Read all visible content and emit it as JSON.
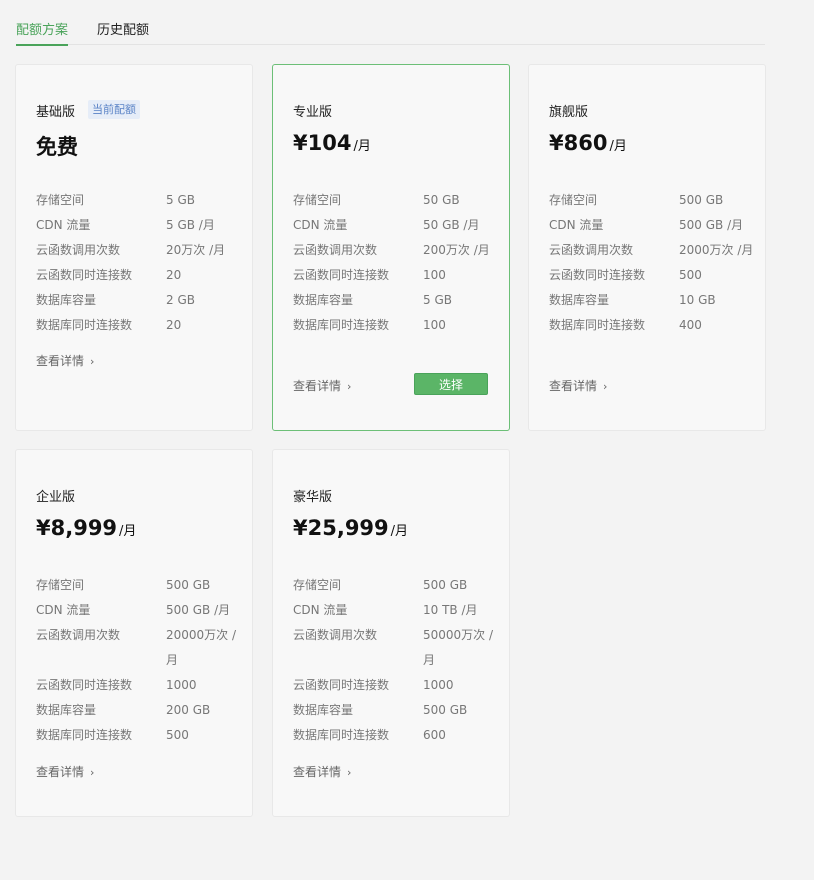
{
  "tabs": [
    {
      "label": "配额方案"
    },
    {
      "label": "历史配额"
    }
  ],
  "colors": {
    "accent": "#4aa35a",
    "badge": "#5a83c6"
  },
  "labels": {
    "storage": "存储空间",
    "cdn": "CDN 流量",
    "calls": "云函数调用次数",
    "concurrency": "云函数同时连接数",
    "db_capacity": "数据库容量",
    "db_connections": "数据库同时连接数",
    "details": "查看详情",
    "select": "选择",
    "current_badge": "当前配额",
    "per_month": "/月"
  },
  "plans": [
    {
      "name": "基础版",
      "price": "免费",
      "storage": "5 GB",
      "cdn": "5 GB /月",
      "calls": "20万次 /月",
      "concurrency": "20",
      "db_capacity": "2 GB",
      "db_connections": "20"
    },
    {
      "name": "专业版",
      "price": "¥104",
      "storage": "50 GB",
      "cdn": "50 GB /月",
      "calls": "200万次 /月",
      "concurrency": "100",
      "db_capacity": "5 GB",
      "db_connections": "100"
    },
    {
      "name": "旗舰版",
      "price": "¥860",
      "storage": "500 GB",
      "cdn": "500 GB /月",
      "calls": "2000万次 /月",
      "concurrency": "500",
      "db_capacity": "10 GB",
      "db_connections": "400"
    },
    {
      "name": "企业版",
      "price": "¥8,999",
      "storage": "500 GB",
      "cdn": "500 GB /月",
      "calls": "20000万次 /月",
      "concurrency": "1000",
      "db_capacity": "200 GB",
      "db_connections": "500"
    },
    {
      "name": "豪华版",
      "price": "¥25,999",
      "storage": "500 GB",
      "cdn": "10 TB /月",
      "calls": "50000万次 /月",
      "concurrency": "1000",
      "db_capacity": "500 GB",
      "db_connections": "600"
    }
  ]
}
